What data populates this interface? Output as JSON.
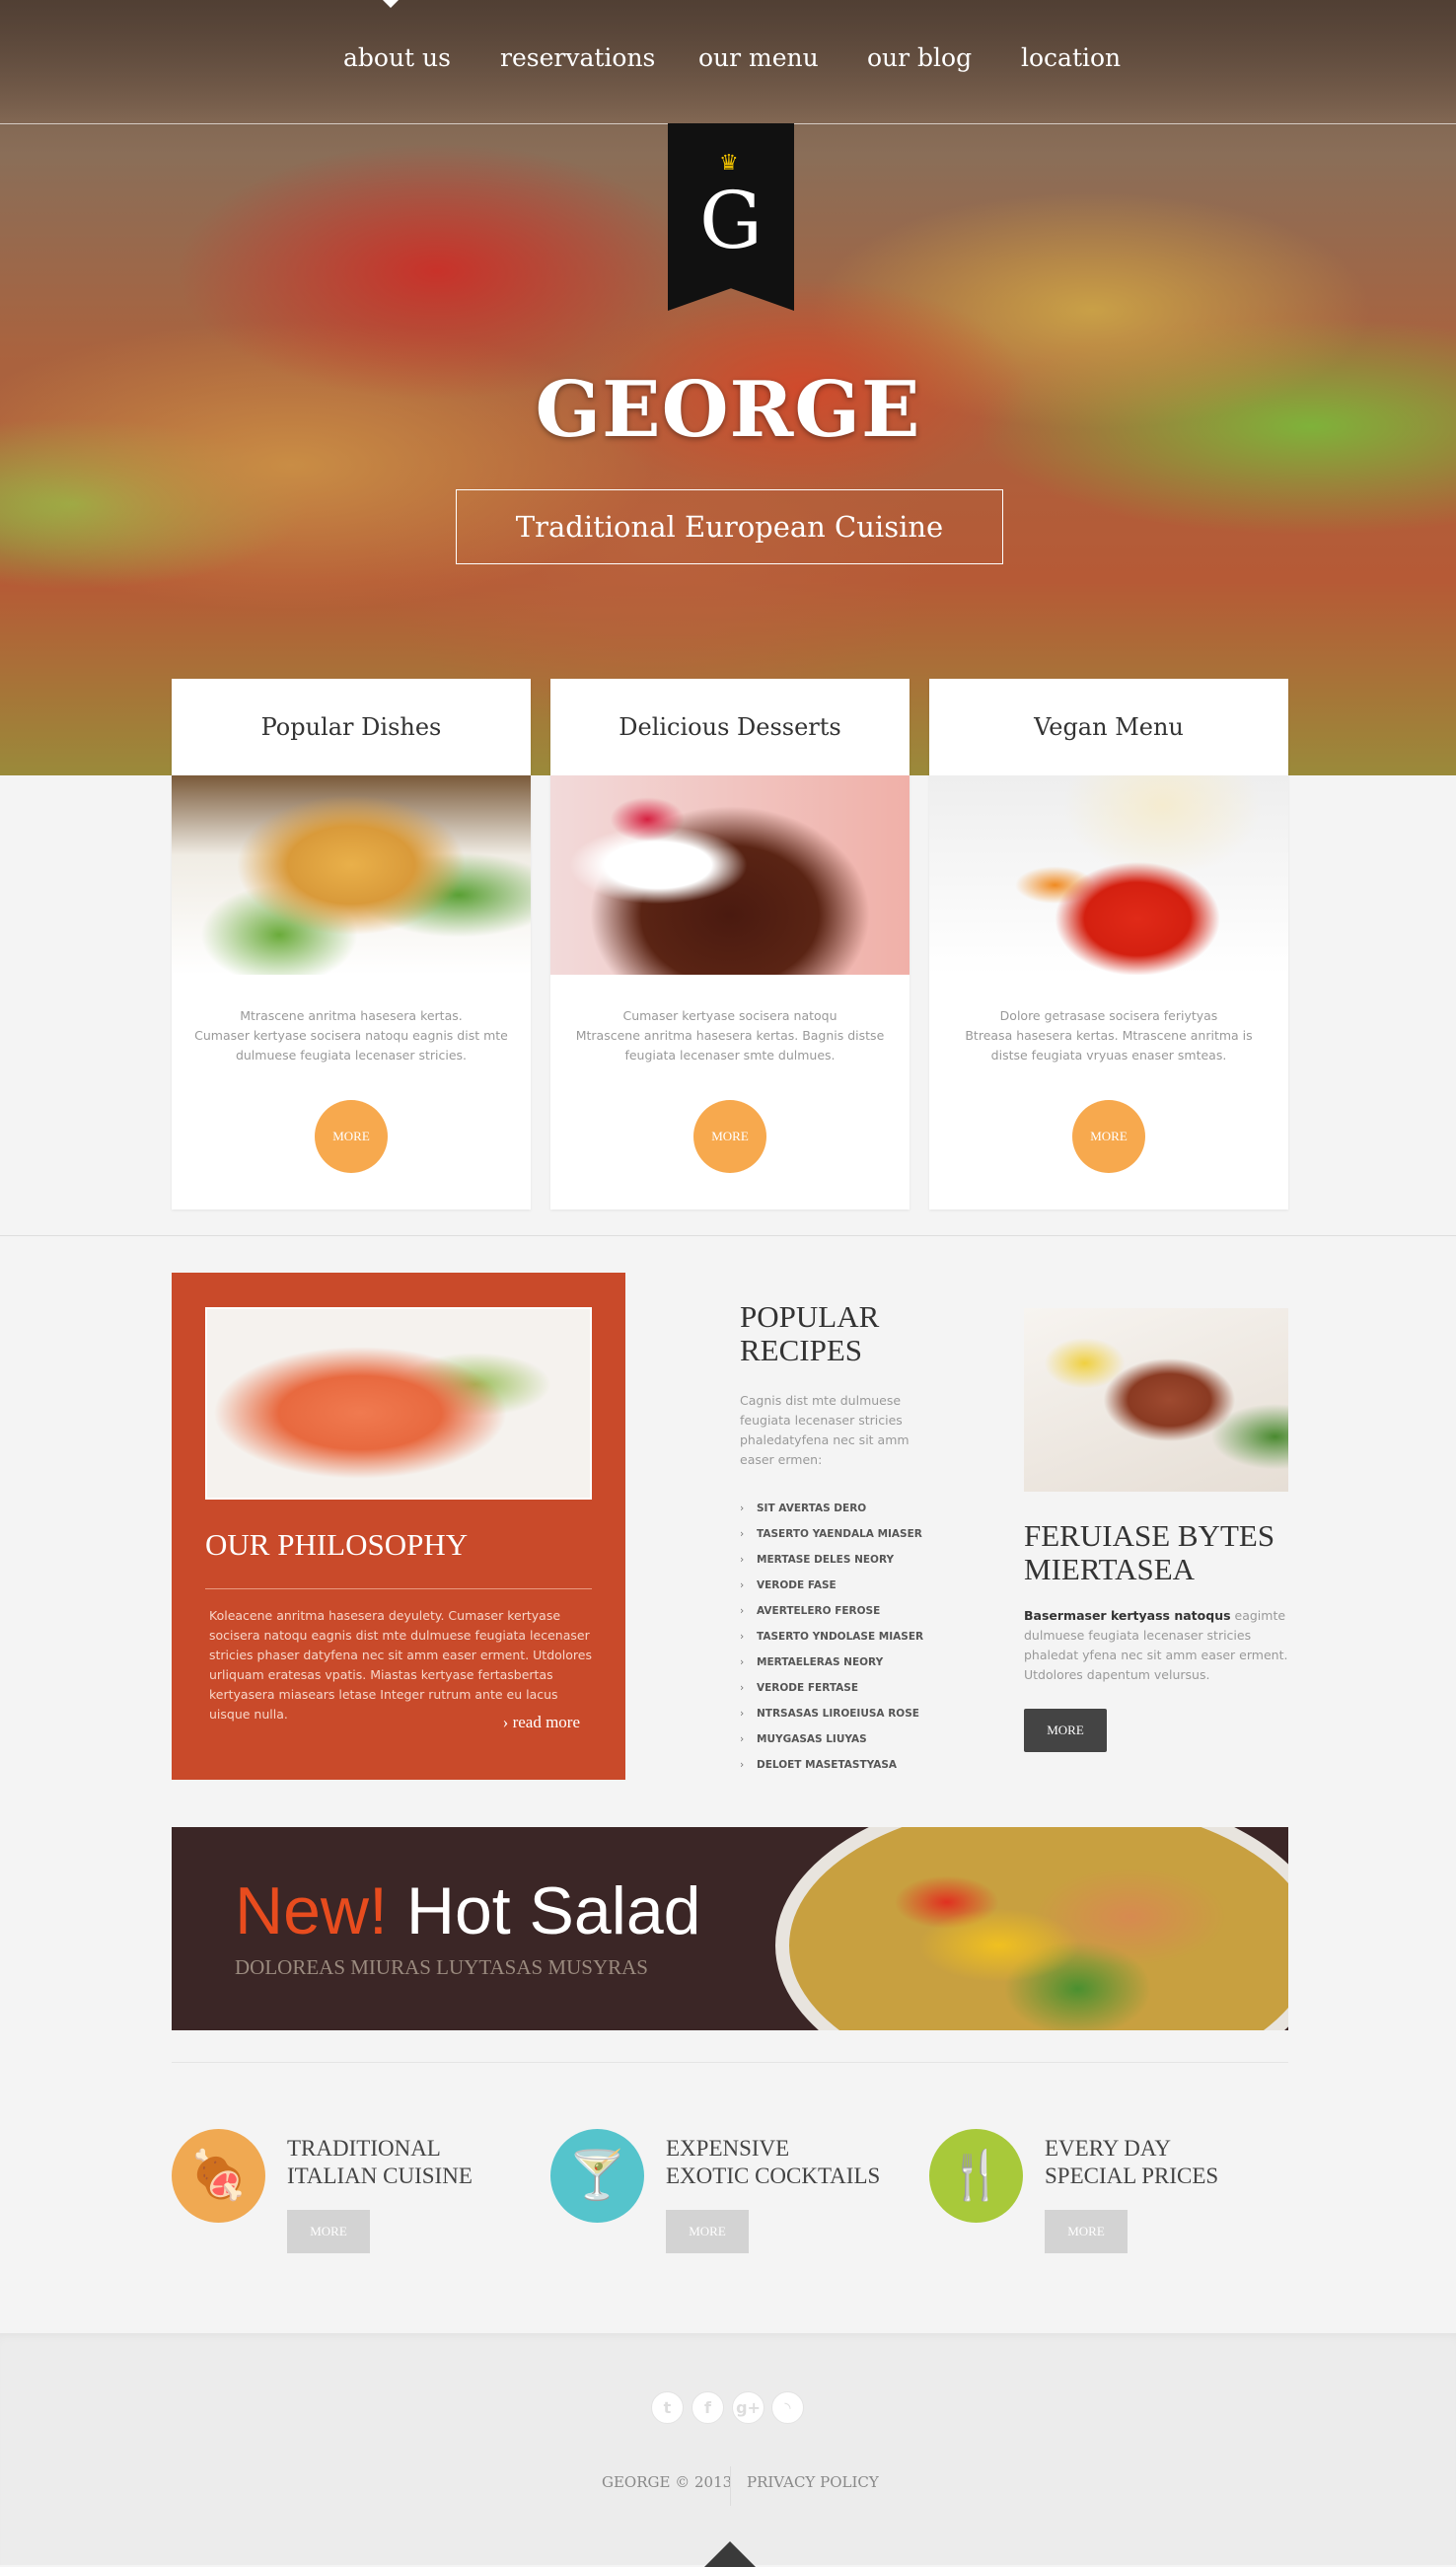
{
  "nav": {
    "items": [
      "about us",
      "reservations",
      "our menu",
      "our blog",
      "location"
    ]
  },
  "hero": {
    "logo_letter": "G",
    "title": "GEORGE",
    "subtitle": "Traditional European Cuisine"
  },
  "cards": [
    {
      "title": "Popular Dishes",
      "text": [
        "Mtrascene anritma hasesera kertas.",
        "Cumaser kertyase socisera natoqu eagnis dist mte",
        "dulmuese feugiata lecenaser stricies."
      ],
      "button": "MORE"
    },
    {
      "title": "Delicious Desserts",
      "text": [
        "Cumaser kertyase socisera natoqu",
        "Mtrascene anritma hasesera kertas.  Bagnis distse",
        "feugiata lecenaser smte dulmues."
      ],
      "button": "MORE"
    },
    {
      "title": "Vegan Menu",
      "text": [
        "Dolore getrasase socisera feriytyas",
        "Btreasa hasesera kertas.  Mtrascene anritma is",
        "distse feugiata vryuas enaser smteas."
      ],
      "button": "MORE"
    }
  ],
  "philosophy": {
    "title": "OUR PHILOSOPHY",
    "text": "Koleacene anritma hasesera deyulety. Cumaser kertyase socisera natoqu eagnis dist mte dulmuese feugiata lecenaser stricies phaser datyfena nec sit amm easer erment. Utdolores urliquam eratesas vpatis. Miastas kertyase fertasbertas kertyasera miasears letase Integer rutrum ante eu lacus uisque nulla.",
    "read_more": "read more"
  },
  "popular_recipes": {
    "title_line1": "POPULAR",
    "title_line2": "RECIPES",
    "text": "Cagnis dist mte dulmuese feugiata lecenaser stricies phaledatyfena nec sit amm easer ermen:",
    "items": [
      "SIT AVERTAS DERO",
      "TASERTO YAENDALA MIASER",
      "MERTASE DELES NEORY",
      "VERODE FASE",
      "AVERTELERO FEROSE",
      "TASERTO YNDOLASE MIASER",
      "MERTAELERAS NEORY",
      "VERODE FERTASE",
      "NTRSASAS LIROEIUSA ROSE",
      "MUYGASAS LIUYAS",
      "DELOET MASETASTYASA"
    ]
  },
  "feature": {
    "title_line1": "FERUIASE BYTES",
    "title_line2": "MIERTASEA",
    "bold": "Basermaser kertyass natoqus",
    "text": " eagimte dulmuese feugiata lecenaser stricies phaledat yfena nec sit amm easer erment. Utdolores dapentum velursus.",
    "button": "MORE"
  },
  "banner": {
    "new": "New!",
    "title": " Hot Salad",
    "subtitle": "DOLOREAS MIURAS LUYTASAS MUSYRAS"
  },
  "features": [
    {
      "icon": "ham-icon",
      "color": "#f0a952",
      "line1": "TRADITIONAL",
      "line2": "ITALIAN CUISINE",
      "button": "MORE"
    },
    {
      "icon": "cocktail-glass-icon",
      "color": "#55c4cc",
      "line1": "EXPENSIVE",
      "line2": "EXOTIC COCKTAILS",
      "button": "MORE"
    },
    {
      "icon": "cutlery-icon",
      "color": "#a8c93a",
      "line1": "EVERY DAY",
      "line2": "SPECIAL PRICES",
      "button": "MORE"
    }
  ],
  "footer": {
    "social": [
      "twitter-icon",
      "facebook-icon",
      "google-plus-icon",
      "rss-icon"
    ],
    "copyright": "GEORGE © 2013",
    "privacy": "PRIVACY POLICY"
  },
  "colors": {
    "accent_orange": "#f7a94e",
    "philosophy_bg": "#c94a2a",
    "banner_bg": "#3b2626",
    "new_red": "#e84c1e"
  }
}
